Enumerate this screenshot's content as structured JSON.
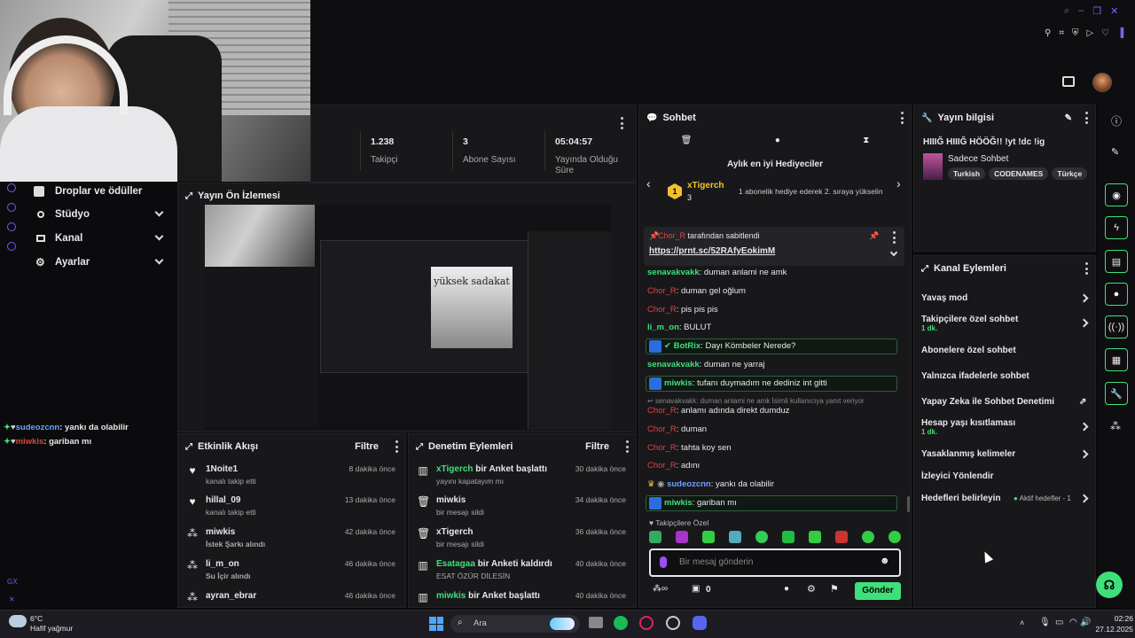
{
  "stats": [
    {
      "value": "1.238",
      "label": "Takipçi"
    },
    {
      "value": "3",
      "label": "Abone Sayısı"
    },
    {
      "value": "05:04:57",
      "label": "Yayında Olduğu Süre"
    }
  ],
  "sidebar": {
    "items": [
      {
        "label": "Droplar ve ödüller"
      },
      {
        "label": "Stüdyo"
      },
      {
        "label": "Kanal"
      },
      {
        "label": "Ayarlar"
      }
    ]
  },
  "preview": {
    "title": "Yayın Ön İzlemesi"
  },
  "overlay_chat": [
    {
      "user": "sudeozcnn",
      "text": ": yankı da olabilir"
    },
    {
      "user": "miwkis",
      "text": ": gariban mı"
    }
  ],
  "activity": {
    "title": "Etkinlik Akışı",
    "filter": "Filtre",
    "items": [
      {
        "name": "1Noite1",
        "sub": "kanalı takip etti",
        "time": "8 dakika önce",
        "icon": "heart-icon"
      },
      {
        "name": "hillal_09",
        "sub": "kanalı takip etti",
        "time": "13 dakika önce",
        "icon": "heart-icon"
      },
      {
        "name": "miwkis",
        "sub": "İstek Şarkı alındı",
        "time": "42 dakika önce",
        "icon": "points-icon"
      },
      {
        "name": "li_m_on",
        "sub": "Su İçir alındı",
        "time": "46 dakika önce",
        "icon": "points-icon"
      },
      {
        "name": "ayran_ebrar",
        "sub": "",
        "time": "46 dakika önce",
        "icon": "points-icon"
      }
    ]
  },
  "moderation": {
    "title": "Denetim Eylemleri",
    "filter": "Filtre",
    "items": [
      {
        "name": "xTigerch",
        "action": " bir Anket başlattı",
        "sub": "yayını kapatayım mı",
        "time": "30 dakika önce",
        "icon": "poll-icon"
      },
      {
        "name": "miwkis",
        "action": "",
        "sub": "bir mesajı sildi",
        "time": "34 dakika önce",
        "icon": "trash-icon"
      },
      {
        "name": "xTigerch",
        "action": "",
        "sub": "bir mesajı sildi",
        "time": "36 dakika önce",
        "icon": "trash-icon"
      },
      {
        "name": "Esatagaa",
        "action": " bir Anketi kaldırdı",
        "sub": "ESAT ÖZÜR DİLESİN",
        "time": "40 dakika önce",
        "icon": "poll-icon"
      },
      {
        "name": "miwkis",
        "action": " bir Anket başlattı",
        "sub": "",
        "time": "40 dakika önce",
        "icon": "poll-icon"
      }
    ]
  },
  "chat": {
    "title": "Sohbet",
    "gifter_title": "Aylık en iyi Hediyeciler",
    "gifter_name": "xTigerch",
    "gifter_count": "3",
    "gifter_hint": "1 abonelik hediye ederek 2. sıraya yükselin",
    "pinned_by": "Chor_R",
    "pinned_suffix": " tarafından sabitlendi",
    "pinned_link": "https://prnt.sc/52RAfyEokimM",
    "messages": [
      {
        "user": "senavakvakk",
        "text": ": duman anlami ne amk",
        "color": "#3ee07a"
      },
      {
        "user": "Chor_R",
        "text": ": duman gel oğlum",
        "color": "#e04343"
      },
      {
        "user": "Chor_R",
        "text": ": pis pis pis",
        "color": "#e04343"
      },
      {
        "user": "li_m_on",
        "text": ": BULUT",
        "color": "#3ee07a"
      },
      {
        "user": "BotRix",
        "text": ": Dayı Kömbeler Nerede?",
        "color": "#3ee07a",
        "boxed": true
      },
      {
        "user": "senavakvakk",
        "text": ": duman ne yarraj",
        "color": "#3ee07a"
      },
      {
        "user": "miwkis",
        "text": ": tufanı duymadım ne dediniz int gitti",
        "color": "#3ee07a",
        "boxed": true
      },
      {
        "user": "Chor_R",
        "text": ": anlamı adında direkt dumduz",
        "color": "#e04343",
        "reply": "senavakvakk: duman anlami ne amk İsimli kullanıcıya yanıt veriyor"
      },
      {
        "user": "Chor_R",
        "text": ": duman",
        "color": "#e04343"
      },
      {
        "user": "Chor_R",
        "text": ": tahta koy sen",
        "color": "#e04343"
      },
      {
        "user": "Chor_R",
        "text": ": adını",
        "color": "#e04343"
      },
      {
        "user": "sudeozcnn",
        "text": ": yankı da olabilir",
        "color": "#6f9fff"
      },
      {
        "user": "miwkis",
        "text": ": gariban mı",
        "color": "#3ee07a",
        "boxed": true
      }
    ],
    "followers_only": "Takipçilere Özel",
    "input_placeholder": "Bir mesaj gönderin",
    "points": "0",
    "send_label": "Gönder"
  },
  "stream_info": {
    "title": "Yayın bilgisi",
    "stream_title": "HIIIĞ HIIIĞ HÖÖĞ!! !yt !dc !ig",
    "category": "Sadece Sohbet",
    "tags": [
      "Turkish",
      "CODENAMES",
      "Türkçe"
    ]
  },
  "channel_actions": {
    "title": "Kanal Eylemleri",
    "items": [
      {
        "label": "Yavaş mod",
        "sub": "",
        "control": "chevron"
      },
      {
        "label": "Takipçilere özel sohbet",
        "sub": "1 dk.",
        "control": "chevron"
      },
      {
        "label": "Abonelere özel sohbet",
        "sub": "",
        "control": "toggle"
      },
      {
        "label": "Yalnızca ifadelerle sohbet",
        "sub": "",
        "control": "toggle"
      },
      {
        "label": "Yapay Zeka ile Sohbet Denetimi",
        "sub": "",
        "control": "external"
      },
      {
        "label": "Hesap yaşı kısıtlaması",
        "sub": "1 dk.",
        "control": "chevron"
      },
      {
        "label": "Yasaklanmış kelimeler",
        "sub": "",
        "control": "chevron"
      },
      {
        "label": "İzleyici Yönlendir",
        "sub": "",
        "control": "none"
      },
      {
        "label": "Hedefleri belirleyin",
        "sub": "",
        "control": "chevron",
        "extra": "Aktif hedefler - 1"
      }
    ]
  },
  "taskbar": {
    "weather_temp": "6°C",
    "weather_desc": "Hafif yağmur",
    "search_label": "Ara",
    "time": "02:26",
    "date": "27.12.2025"
  },
  "colors": {
    "accent": "#3ee07a",
    "danger": "#e04343",
    "panel": "#18181b"
  }
}
